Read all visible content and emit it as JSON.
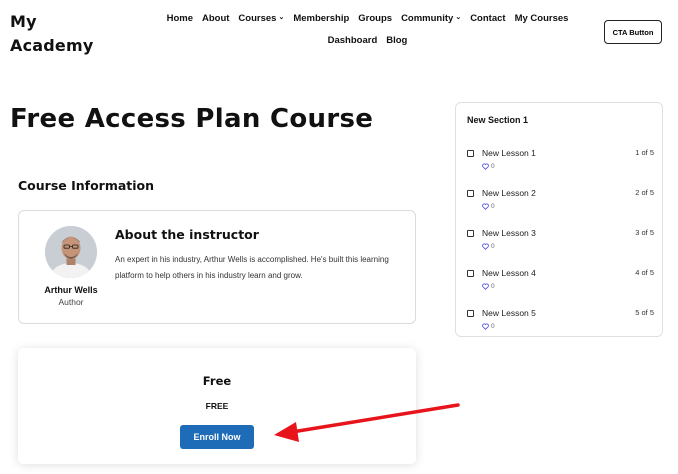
{
  "site": {
    "logo_line1": "My",
    "logo_line2": "Academy",
    "nav": [
      {
        "label": "Home",
        "dropdown": false
      },
      {
        "label": "About",
        "dropdown": false
      },
      {
        "label": "Courses",
        "dropdown": true
      },
      {
        "label": "Membership",
        "dropdown": false
      },
      {
        "label": "Groups",
        "dropdown": false
      },
      {
        "label": "Community",
        "dropdown": true
      },
      {
        "label": "Contact",
        "dropdown": false
      },
      {
        "label": "My Courses",
        "dropdown": false
      },
      {
        "label": "Dashboard",
        "dropdown": false
      },
      {
        "label": "Blog",
        "dropdown": false
      }
    ],
    "cta_label": "CTA Button"
  },
  "course": {
    "title": "Free Access Plan Course",
    "info_heading": "Course Information"
  },
  "instructor": {
    "heading": "About the instructor",
    "bio": "An expert in his industry, Arthur Wells is accomplished. He's built this learning platform to help others in his industry learn and grow.",
    "name": "Arthur Wells",
    "role": "Author"
  },
  "plan": {
    "name": "Free",
    "price": "FREE",
    "button_label": "Enroll Now",
    "button_color": "#1e6bb8"
  },
  "syllabus": {
    "section_title": "New Section 1",
    "lessons": [
      {
        "name": "New Lesson 1",
        "count": "1 of 5",
        "likes": "0"
      },
      {
        "name": "New Lesson 2",
        "count": "2 of 5",
        "likes": "0"
      },
      {
        "name": "New Lesson 3",
        "count": "3 of 5",
        "likes": "0"
      },
      {
        "name": "New Lesson 4",
        "count": "4 of 5",
        "likes": "0"
      },
      {
        "name": "New Lesson 5",
        "count": "5 of 5",
        "likes": "0"
      }
    ],
    "heart_color": "#4a4ae0"
  },
  "annotation": {
    "arrow_color": "#e8141c"
  }
}
